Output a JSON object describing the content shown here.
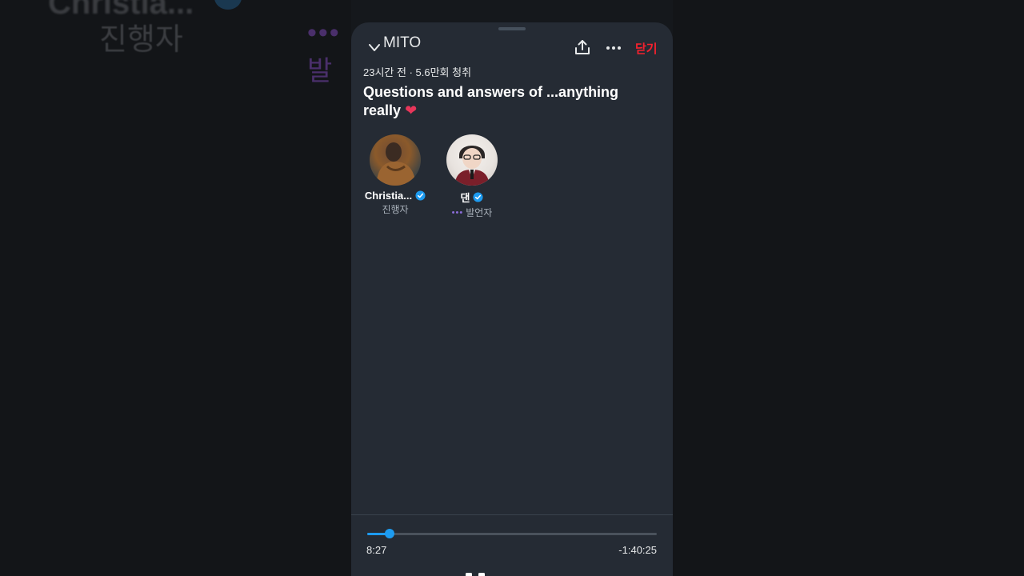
{
  "background": {
    "ghost_name": "Christia...",
    "ghost_role": "진행자",
    "ghost_dots": "••• 발"
  },
  "header": {
    "host_name": "MITO",
    "close_label": "닫기"
  },
  "space": {
    "meta": "23시간 전 · 5.6만회 청취",
    "title": "Questions and answers of ...anything really",
    "title_emoji": "❤",
    "accent": "#1d9bf0",
    "close_color": "#f4212e"
  },
  "participants": [
    {
      "name": "Christia...",
      "verified": true,
      "role": "진행자",
      "speaking": false
    },
    {
      "name": "댄",
      "verified": true,
      "role": "발언자",
      "speaking": true,
      "speaking_indicator": "•••"
    }
  ],
  "playback": {
    "elapsed": "8:27",
    "remaining": "-1:40:25",
    "progress_fraction": 0.077,
    "state_icon": "pause-icon"
  },
  "icons": [
    "chevron-down-icon",
    "share-icon",
    "more-icon",
    "verified-badge-icon",
    "pause-icon"
  ]
}
